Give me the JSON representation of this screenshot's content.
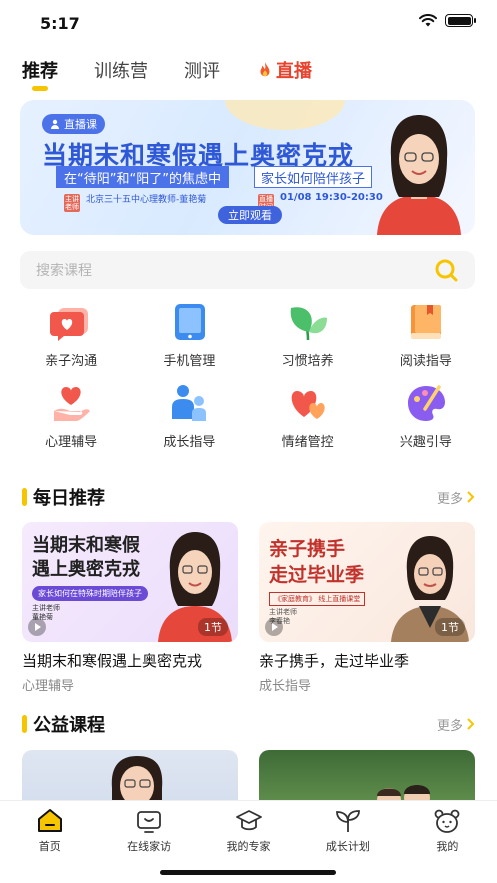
{
  "status_bar": {
    "time": "5:17"
  },
  "top_tabs": [
    {
      "label": "推荐",
      "active": true
    },
    {
      "label": "训练营",
      "active": false
    },
    {
      "label": "测评",
      "active": false
    },
    {
      "label": "直播",
      "active": false
    }
  ],
  "banner": {
    "tag": "直播课",
    "title": "当期末和寒假遇上奥密克戎",
    "sub_left": "在“待阳”和“阳了”的焦虑中",
    "sub_right": "家长如何陪伴孩子",
    "label_teacher": "主讲老师",
    "teacher": "北京三十五中心理教师-董艳菊",
    "label_time": "直播时间",
    "time": "01/08 19:30-20:30",
    "cta": "立即观看"
  },
  "search": {
    "placeholder": "搜索课程"
  },
  "categories": [
    {
      "label": "亲子沟通",
      "icon": "chat-heart-icon",
      "color": "#f2574c"
    },
    {
      "label": "手机管理",
      "icon": "tablet-icon",
      "color": "#3c8cf0"
    },
    {
      "label": "习惯培养",
      "icon": "leaf-icon",
      "color": "#4cbf6a"
    },
    {
      "label": "阅读指导",
      "icon": "book-icon",
      "color": "#f7943a"
    },
    {
      "label": "心理辅导",
      "icon": "hand-heart-icon",
      "color": "#f2574c"
    },
    {
      "label": "成长指导",
      "icon": "parent-child-icon",
      "color": "#3c8cf0"
    },
    {
      "label": "情绪管控",
      "icon": "hearts-icon",
      "color": "#f2574c"
    },
    {
      "label": "兴趣引导",
      "icon": "palette-icon",
      "color": "#8a5cf0"
    }
  ],
  "daily": {
    "title": "每日推荐",
    "more": "更多",
    "courses": [
      {
        "thumb_title_1": "当期末和寒假",
        "thumb_title_2": "遇上奥密克戎",
        "thumb_sub": "家长如何在特殊时期陪伴孩子",
        "thumb_small_1": "主讲老师",
        "thumb_small_2": "董艳菊",
        "lessons": "1节",
        "title": "当期末和寒假遇上奥密克戎",
        "category": "心理辅导"
      },
      {
        "thumb_title_1": "亲子携手",
        "thumb_title_2": "走过毕业季",
        "thumb_sub": "《家庭教育》 线上直播课堂",
        "thumb_small_1": "主讲老师",
        "thumb_small_2": "李春艳",
        "lessons": "1节",
        "title": "亲子携手，走过毕业季",
        "category": "成长指导"
      }
    ]
  },
  "public": {
    "title": "公益课程",
    "more": "更多"
  },
  "bottom_nav": [
    {
      "label": "首页",
      "icon": "home-icon",
      "active": true
    },
    {
      "label": "在线家访",
      "icon": "video-visit-icon",
      "active": false
    },
    {
      "label": "我的专家",
      "icon": "graduation-cap-icon",
      "active": false
    },
    {
      "label": "成长计划",
      "icon": "sprout-icon",
      "active": false
    },
    {
      "label": "我的",
      "icon": "bear-face-icon",
      "active": false
    }
  ],
  "colors": {
    "accent": "#f7c500",
    "live": "#e8432e",
    "banner_blue": "#2f58d6"
  }
}
